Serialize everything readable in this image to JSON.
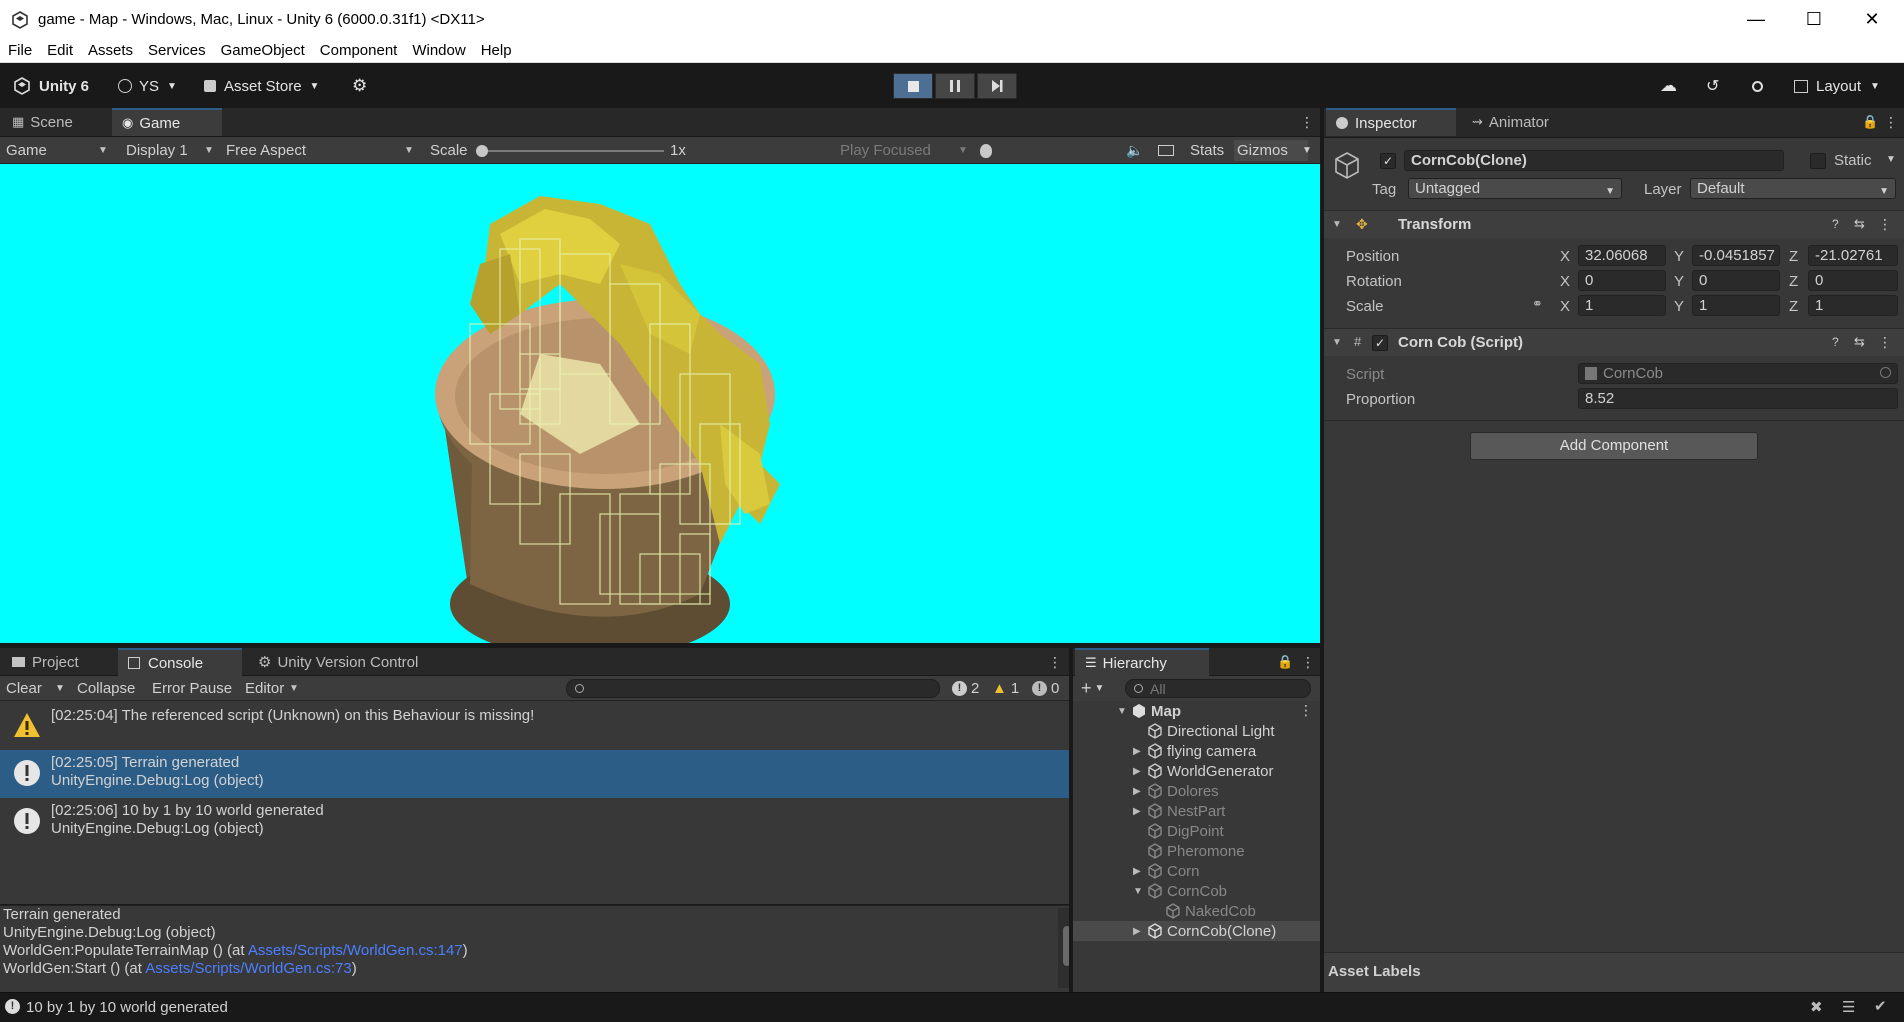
{
  "window": {
    "title": "game - Map - Windows, Mac, Linux - Unity 6 (6000.0.31f1) <DX11>"
  },
  "menu": [
    "File",
    "Edit",
    "Assets",
    "Services",
    "GameObject",
    "Component",
    "Window",
    "Help"
  ],
  "toolbar": {
    "unity_label": "Unity 6",
    "account_label": "YS",
    "asset_store_label": "Asset Store",
    "layout_label": "Layout"
  },
  "scene_tabs": {
    "scene": "Scene",
    "game": "Game"
  },
  "game_toolbar": {
    "mode": "Game",
    "display": "Display 1",
    "aspect": "Free Aspect",
    "scale_label": "Scale",
    "scale_value": "1x",
    "play_focused": "Play Focused",
    "stats": "Stats",
    "gizmos": "Gizmos"
  },
  "bottom_tabs": {
    "project": "Project",
    "console": "Console",
    "version_control": "Unity Version Control"
  },
  "console": {
    "clear": "Clear",
    "collapse": "Collapse",
    "error_pause": "Error Pause",
    "editor": "Editor",
    "count_log": "2",
    "count_warn": "1",
    "count_error": "0",
    "entries": [
      {
        "type": "warning",
        "line1": "[02:25:04] The referenced script (Unknown) on this Behaviour is missing!",
        "line2": ""
      },
      {
        "type": "log",
        "line1": "[02:25:05] Terrain generated",
        "line2": "UnityEngine.Debug:Log (object)",
        "selected": true
      },
      {
        "type": "log",
        "line1": "[02:25:06] 10 by 1 by 10 world generated",
        "line2": "UnityEngine.Debug:Log (object)"
      }
    ],
    "detail": {
      "line1": "Terrain generated",
      "line2": "UnityEngine.Debug:Log (object)",
      "line3_prefix": "WorldGen:PopulateTerrainMap () (at ",
      "line3_link": "Assets/Scripts/WorldGen.cs:147",
      "line3_suffix": ")",
      "line4_prefix": "WorldGen:Start () (at ",
      "line4_link": "Assets/Scripts/WorldGen.cs:73",
      "line4_suffix": ")"
    }
  },
  "hierarchy": {
    "tab": "Hierarchy",
    "search_placeholder": "All",
    "items": [
      {
        "name": "Map",
        "depth": 0,
        "expanded": true,
        "bold": true
      },
      {
        "name": "Directional Light",
        "depth": 1
      },
      {
        "name": "flying camera",
        "depth": 1,
        "collapsed": true
      },
      {
        "name": "WorldGenerator",
        "depth": 1,
        "collapsed": true
      },
      {
        "name": "Dolores",
        "depth": 1,
        "collapsed": true,
        "dim": true
      },
      {
        "name": "NestPart",
        "depth": 1,
        "collapsed": true,
        "dim": true
      },
      {
        "name": "DigPoint",
        "depth": 1,
        "dim": true
      },
      {
        "name": "Pheromone",
        "depth": 1,
        "dim": true
      },
      {
        "name": "Corn",
        "depth": 1,
        "collapsed": true,
        "dim": true
      },
      {
        "name": "CornCob",
        "depth": 1,
        "expanded": true,
        "dim": true
      },
      {
        "name": "NakedCob",
        "depth": 2,
        "dim": true
      },
      {
        "name": "CornCob(Clone)",
        "depth": 1,
        "collapsed": true,
        "selected": true
      }
    ]
  },
  "inspector": {
    "tab_inspector": "Inspector",
    "tab_animator": "Animator",
    "object_name": "CornCob(Clone)",
    "static_label": "Static",
    "tag_label": "Tag",
    "tag_value": "Untagged",
    "layer_label": "Layer",
    "layer_value": "Default",
    "transform": {
      "title": "Transform",
      "position_label": "Position",
      "rotation_label": "Rotation",
      "scale_label": "Scale",
      "position": {
        "x": "32.06068",
        "y": "-0.0451857",
        "z": "-21.02761"
      },
      "rotation": {
        "x": "0",
        "y": "0",
        "z": "0"
      },
      "scale": {
        "x": "1",
        "y": "1",
        "z": "1"
      }
    },
    "script_component": {
      "title": "Corn Cob (Script)",
      "script_label": "Script",
      "script_value": "CornCob",
      "proportion_label": "Proportion",
      "proportion_value": "8.52"
    },
    "add_component": "Add Component",
    "asset_labels": "Asset Labels"
  },
  "statusbar": {
    "message": "10 by 1 by 10 world generated"
  },
  "axes": {
    "x": "X",
    "y": "Y",
    "z": "Z"
  }
}
